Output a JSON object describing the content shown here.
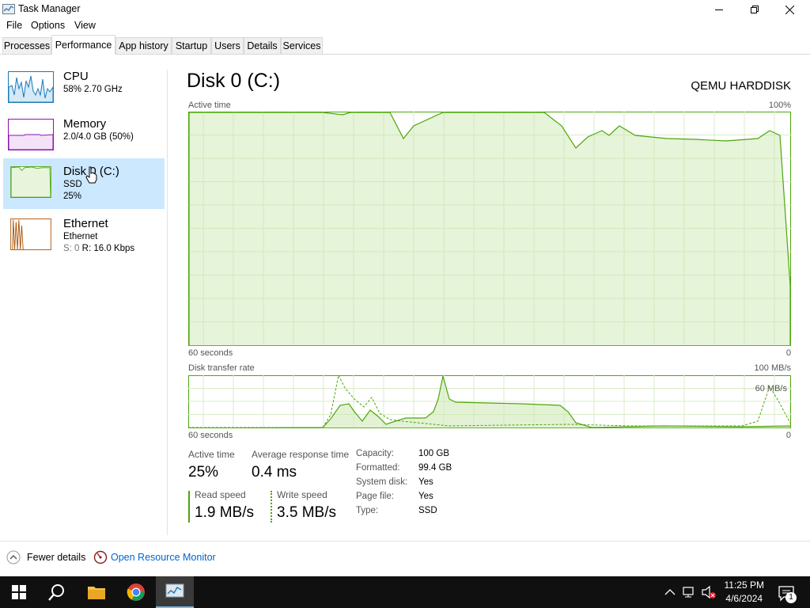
{
  "window": {
    "title": "Task Manager",
    "menu": [
      "File",
      "Options",
      "View"
    ],
    "tabs": [
      "Processes",
      "Performance",
      "App history",
      "Startup",
      "Users",
      "Details",
      "Services"
    ],
    "active_tab": "Performance"
  },
  "sidebar": {
    "items": [
      {
        "name": "CPU",
        "line1": "58%  2.70 GHz",
        "line2": "",
        "color": "#1a7ab8"
      },
      {
        "name": "Memory",
        "line1": "2.0/4.0 GB (50%)",
        "line2": "",
        "color": "#8b12ae"
      },
      {
        "name": "Disk 0 (C:)",
        "line1": "SSD",
        "line2": "25%",
        "color": "#4da60c"
      },
      {
        "name": "Ethernet",
        "line1": "Ethernet",
        "line2": "R: 16.0 Kbps",
        "line2_prefix": "S: 0",
        "color": "#a74f01"
      }
    ],
    "selected": 2
  },
  "main": {
    "title": "Disk 0 (C:)",
    "device": "QEMU HARDDISK",
    "chart1": {
      "label": "Active time",
      "max": "100%",
      "left": "60 seconds",
      "right": "0"
    },
    "chart2": {
      "label": "Disk transfer rate",
      "max": "100 MB/s",
      "mid": "60 MB/s",
      "left": "60 seconds",
      "right": "0"
    },
    "stats": {
      "active_time_label": "Active time",
      "active_time_value": "25%",
      "avg_resp_label": "Average response time",
      "avg_resp_value": "0.4 ms",
      "read_label": "Read speed",
      "read_value": "1.9 MB/s",
      "write_label": "Write speed",
      "write_value": "3.5 MB/s"
    },
    "props": [
      {
        "label": "Capacity:",
        "value": "100 GB"
      },
      {
        "label": "Formatted:",
        "value": "99.4 GB"
      },
      {
        "label": "System disk:",
        "value": "Yes"
      },
      {
        "label": "Page file:",
        "value": "Yes"
      },
      {
        "label": "Type:",
        "value": "SSD"
      }
    ]
  },
  "footer": {
    "fewer_details": "Fewer details",
    "resource_monitor": "Open Resource Monitor"
  },
  "taskbar": {
    "time": "11:25 PM",
    "date": "4/6/2024",
    "notification_count": "1"
  },
  "colors": {
    "disk": "#4da60c",
    "disk_fill": "#e8f5dc",
    "selected": "#cce8ff",
    "link": "#0066cc"
  }
}
